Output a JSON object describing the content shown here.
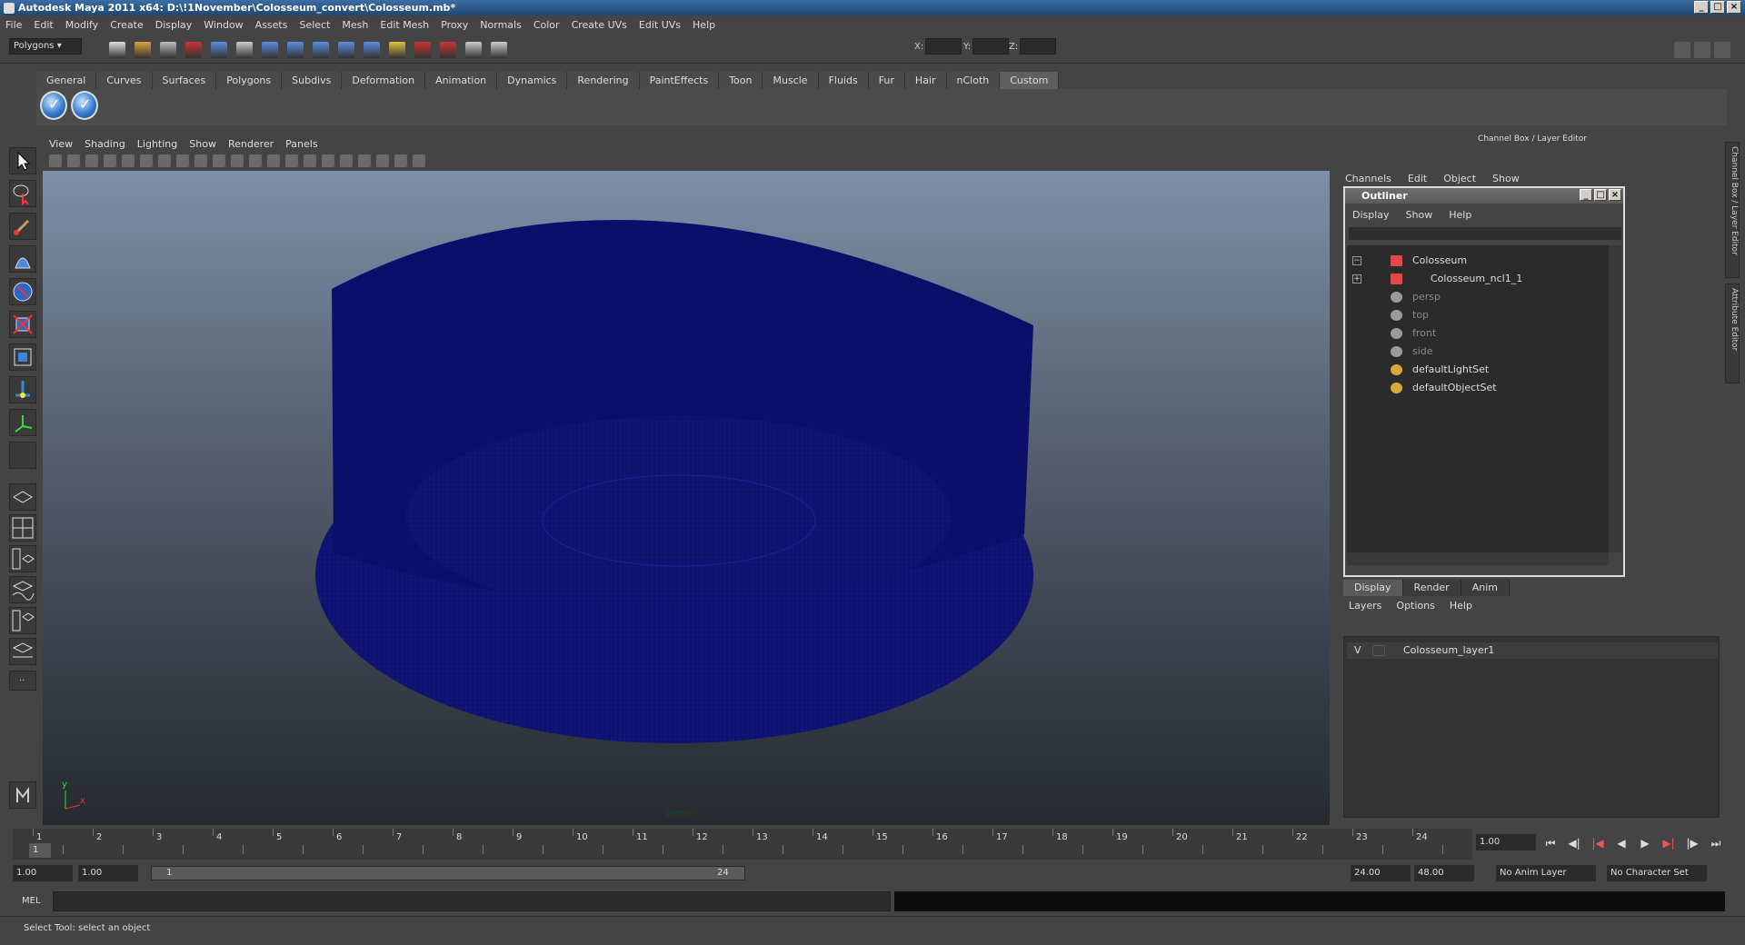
{
  "window": {
    "title": "Autodesk Maya 2011 x64: D:\\!1November\\Colosseum_convert\\Colosseum.mb*"
  },
  "menubar": [
    "File",
    "Edit",
    "Modify",
    "Create",
    "Display",
    "Window",
    "Assets",
    "Select",
    "Mesh",
    "Edit Mesh",
    "Proxy",
    "Normals",
    "Color",
    "Create UVs",
    "Edit UVs",
    "Help"
  ],
  "statusline": {
    "mode": "Polygons",
    "x_label": "X:",
    "y_label": "Y:",
    "z_label": "Z:"
  },
  "shelf": {
    "tabs": [
      "General",
      "Curves",
      "Surfaces",
      "Polygons",
      "Subdivs",
      "Deformation",
      "Animation",
      "Dynamics",
      "Rendering",
      "PaintEffects",
      "Toon",
      "Muscle",
      "Fluids",
      "Fur",
      "Hair",
      "nCloth",
      "Custom"
    ],
    "active_tab": "Custom"
  },
  "viewport": {
    "menu": [
      "View",
      "Shading",
      "Lighting",
      "Show",
      "Renderer",
      "Panels"
    ],
    "camera_label": "persp",
    "axis_y": "y",
    "axis_x": "x",
    "mesh_color": "#0b0f6a"
  },
  "channel_box": {
    "title": "Channel Box / Layer Editor",
    "menu": [
      "Channels",
      "Edit",
      "Object",
      "Show"
    ]
  },
  "side_tabs": [
    "Channel Box / Layer Editor",
    "Attribute Editor"
  ],
  "outliner": {
    "title": "Outliner",
    "menu": [
      "Display",
      "Show",
      "Help"
    ],
    "items": [
      {
        "label": "Colosseum",
        "icon": "mesh-icon",
        "expander": "−",
        "child": false,
        "dim": false
      },
      {
        "label": "Colosseum_ncl1_1",
        "icon": "mesh-icon",
        "expander": "+",
        "child": true,
        "dim": false
      },
      {
        "label": "persp",
        "icon": "camera-icon",
        "expander": "",
        "child": false,
        "dim": true
      },
      {
        "label": "top",
        "icon": "camera-icon",
        "expander": "",
        "child": false,
        "dim": true
      },
      {
        "label": "front",
        "icon": "camera-icon",
        "expander": "",
        "child": false,
        "dim": true
      },
      {
        "label": "side",
        "icon": "camera-icon",
        "expander": "",
        "child": false,
        "dim": true
      },
      {
        "label": "defaultLightSet",
        "icon": "set-icon",
        "expander": "",
        "child": false,
        "dim": false
      },
      {
        "label": "defaultObjectSet",
        "icon": "set-icon",
        "expander": "",
        "child": false,
        "dim": false
      }
    ]
  },
  "layer_editor": {
    "tabs": [
      "Display",
      "Render",
      "Anim"
    ],
    "active_tab": "Display",
    "menu": [
      "Layers",
      "Options",
      "Help"
    ],
    "layers": [
      {
        "visible": "V",
        "name": "Colosseum_layer1"
      }
    ]
  },
  "timeline": {
    "ticks": [
      "1",
      "2",
      "3",
      "4",
      "5",
      "6",
      "7",
      "8",
      "9",
      "10",
      "11",
      "12",
      "13",
      "14",
      "15",
      "16",
      "17",
      "18",
      "19",
      "20",
      "21",
      "22",
      "23",
      "24"
    ],
    "current_marker": "1",
    "current_frame": "1.00"
  },
  "range": {
    "start": "1.00",
    "playback_start": "1.00",
    "slider_start": "1",
    "slider_end": "24",
    "playback_end": "24.00",
    "end": "48.00",
    "anim_layer": "No Anim Layer",
    "character_set": "No Character Set"
  },
  "command_line": {
    "label": "MEL"
  },
  "help_line": {
    "text": "Select Tool: select an object"
  }
}
